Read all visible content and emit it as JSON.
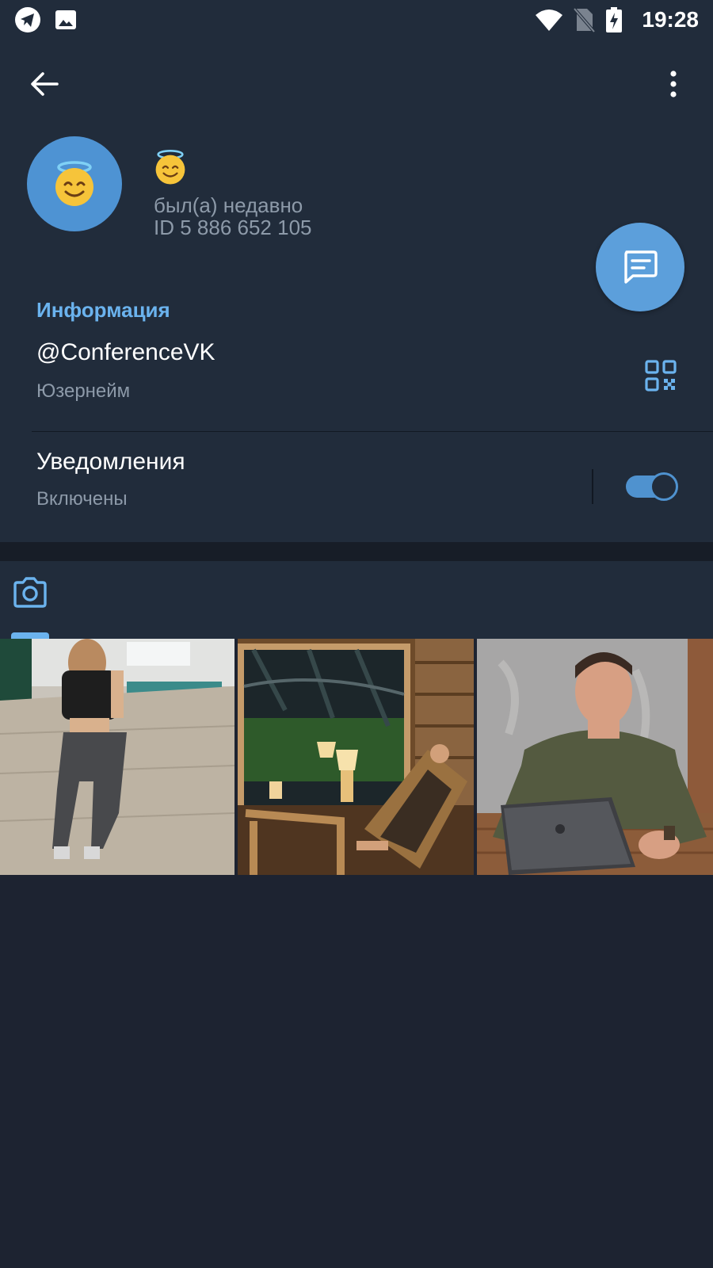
{
  "status_bar": {
    "time": "19:28",
    "left_icons": [
      "telegram-notification-icon",
      "gallery-notification-icon"
    ],
    "right_icons": [
      "wifi-icon",
      "no-sim-icon",
      "battery-charging-icon"
    ]
  },
  "toolbar": {
    "back_icon": "arrow-left-icon",
    "menu_icon": "more-vertical-icon"
  },
  "profile": {
    "avatar_emoji": "😇",
    "name": "😇",
    "last_seen": "был(а) недавно",
    "user_id": "ID 5 886 652 105",
    "avatar_color": "#4e93d3"
  },
  "info": {
    "section_title": "Информация",
    "username": "@ConferenceVK",
    "username_caption": "Юзернейм",
    "notifications_label": "Уведомления",
    "notifications_status": "Включены",
    "notifications_enabled": true
  },
  "media": {
    "active_tab_icon": "camera-icon",
    "photos": [
      {
        "description_icon": "photo-woman-gym"
      },
      {
        "description_icon": "photo-sauna-lounge"
      },
      {
        "description_icon": "photo-man-laptop"
      }
    ]
  },
  "colors": {
    "background": "#1d2331",
    "panel": "#212c3b",
    "accent": "#6bb3ee",
    "fab": "#5c9fdb",
    "muted_text": "#8d9aa9"
  }
}
